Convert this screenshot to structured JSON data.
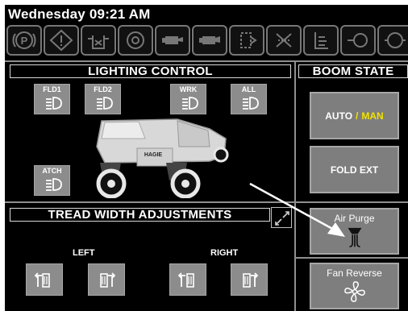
{
  "status": {
    "clock": "Wednesday 09:21 AM"
  },
  "warning_icons": [
    "parking-brake-icon",
    "warning-diamond-icon",
    "fluid-level-icon",
    "oil-filter-icon",
    "oil-pressure-icon",
    "engine-oil-icon",
    "transmission-icon",
    "hydraulic-warning-icon",
    "fuel-level-icon",
    "engine-temp-icon",
    "engine-service-icon"
  ],
  "lighting": {
    "title": "LIGHTING CONTROL",
    "buttons": [
      {
        "label": "FLD1",
        "icon": "headlight-icon"
      },
      {
        "label": "FLD2",
        "icon": "headlight-icon"
      },
      {
        "label": "WRK",
        "icon": "headlight-icon"
      },
      {
        "label": "ALL",
        "icon": "headlight-icon"
      },
      {
        "label": "ATCH",
        "icon": "headlight-icon"
      }
    ],
    "vehicle_logo": "HAGIE"
  },
  "boom": {
    "title": "BOOM STATE",
    "auto_label": "AUTO",
    "separator": "/",
    "man_label": "MAN",
    "fold_label": "FOLD EXT"
  },
  "tread": {
    "title": "TREAD WIDTH ADJUSTMENTS",
    "left_label": "LEFT",
    "right_label": "RIGHT"
  },
  "controls": {
    "air_purge_label": "Air Purge",
    "fan_reverse_label": "Fan Reverse"
  },
  "colors": {
    "man_highlight": "#f2e200",
    "button_gray": "#8c8c8c",
    "frame_gray": "#8f8f8f"
  }
}
